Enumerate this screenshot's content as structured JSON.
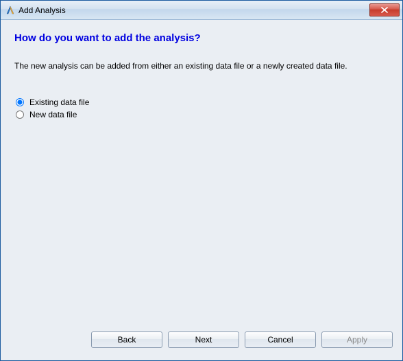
{
  "window": {
    "title": "Add Analysis"
  },
  "heading": "How do you want to add the analysis?",
  "description": "The new analysis can be added from either an existing data file or a newly created data file.",
  "options": {
    "existing": "Existing data file",
    "newfile": "New data file",
    "selected": "existing"
  },
  "buttons": {
    "back": "Back",
    "next": "Next",
    "cancel": "Cancel",
    "apply": "Apply"
  }
}
